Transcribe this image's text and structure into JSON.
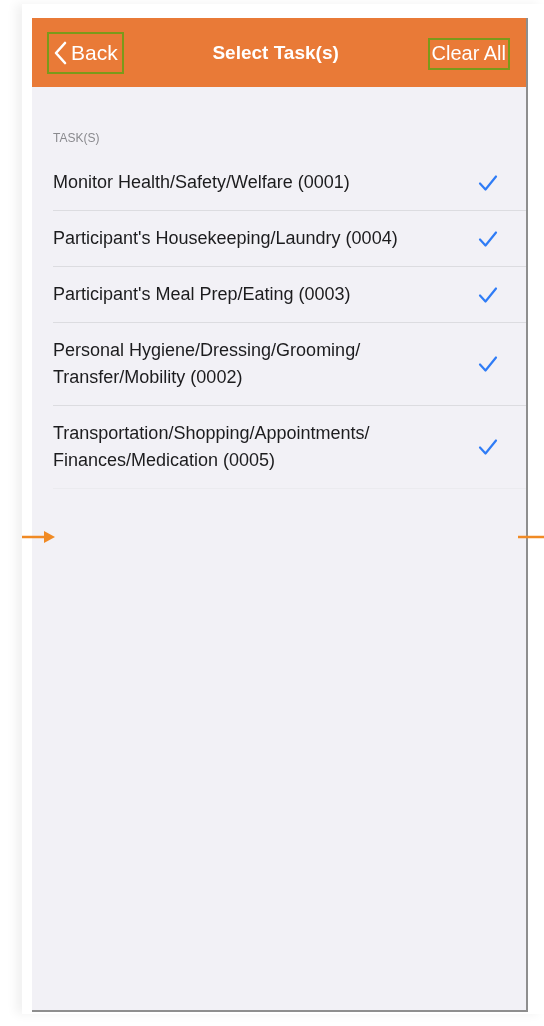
{
  "nav": {
    "back": "Back",
    "title": "Select Task(s)",
    "action": "Clear All"
  },
  "section": "TASK(S)",
  "tasks": [
    {
      "label": "Monitor Health/Safety/Welfare (0001)",
      "checked": true
    },
    {
      "label": "Participant's Housekeeping/Laundry (0004)",
      "checked": true
    },
    {
      "label": "Participant's Meal Prep/Eating (0003)",
      "checked": true
    },
    {
      "label": "Personal Hygiene/Dressing/Grooming/ Transfer/Mobility (0002)",
      "checked": true
    },
    {
      "label": "Transportation/Shopping/Appointments/ Finances/Medication (0005)",
      "checked": true
    }
  ]
}
